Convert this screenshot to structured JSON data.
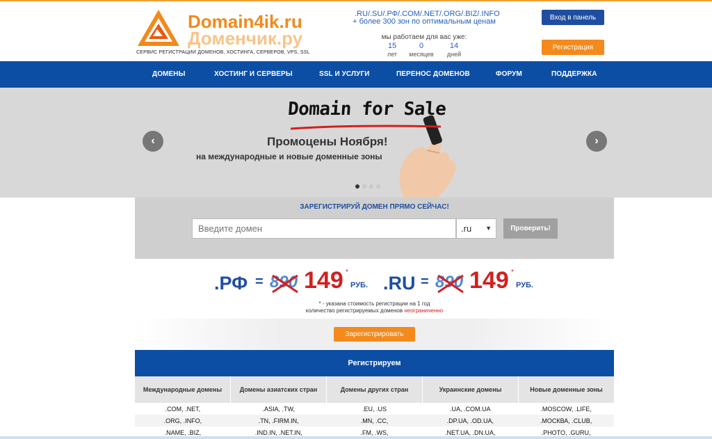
{
  "header": {
    "logo_en": "Domain4ik.ru",
    "logo_ru": "Доменчик.ру",
    "tagline": "СЕРВИС РЕГИСТРАЦИИ ДОМЕНОВ, ХОСТИНГА, СЕРВЕРОВ, VPS, SSL",
    "zones_line1": ".RU/.SU/.РФ/.COM/.NET/.ORG/.BIZ/.INFO",
    "zones_line2": "+ более 300 зон по оптимальным ценам",
    "working_label": "мы работаем для вас уже:",
    "counters": [
      {
        "value": "15",
        "unit": "лет"
      },
      {
        "value": "0",
        "unit": "месяцев"
      },
      {
        "value": "14",
        "unit": "дней"
      }
    ],
    "login_label": "Вход в панель",
    "register_label": "Регистрация"
  },
  "nav": {
    "items": [
      {
        "label": "ДОМЕНЫ"
      },
      {
        "label": "ХОСТИНГ И СЕРВЕРЫ"
      },
      {
        "label": "SSL И УСЛУГИ"
      },
      {
        "label": "ПЕРЕНОС ДОМЕНОВ"
      },
      {
        "label": "ФОРУМ"
      },
      {
        "label": "ПОДДЕРЖКА"
      }
    ]
  },
  "banner": {
    "title": "Domain for Sale",
    "promo_line1": "Промоцены Ноября!",
    "promo_line2": "на международные и новые доменные зоны",
    "prev_icon": "chevron-left-icon",
    "next_icon": "chevron-right-icon",
    "slides_total": 4,
    "active_slide": 1
  },
  "search": {
    "title": "ЗАРЕГИСТРИРУЙ ДОМЕН ПРЯМО СЕЙЧАС!",
    "placeholder": "Введите домен",
    "zone_selected": ".ru",
    "check_label": "Проверить!"
  },
  "prices": [
    {
      "zone": ".РФ",
      "eq": "=",
      "old": "890",
      "new": "149",
      "star": "*",
      "currency": "РУБ."
    },
    {
      "zone": ".RU",
      "eq": "=",
      "old": "890",
      "new": "149",
      "star": "*",
      "currency": "РУБ."
    }
  ],
  "notes": {
    "line1": "* - указана стоимость регистрации на 1 год",
    "line2_prefix": "количество регистрируемых доменов ",
    "line2_highlight": "неограниченно"
  },
  "register_button": "Зарегистрировать",
  "table": {
    "title": "Регистрируем",
    "columns": [
      "Международные домены",
      "Домены азиатских стран",
      "Домены других стран",
      "Украинские домены",
      "Новые доменные зоны"
    ],
    "rows": [
      [
        ".COM, .NET,",
        ".ASIA, .TW,",
        ".EU, .US",
        ".UA, .COM.UA",
        ".MOSCOW, .LIFE,"
      ],
      [
        ".ORG, .INFO,",
        ".TN, .FIRM.IN,",
        ".MN, .CC,",
        ".DP.UA, .OD.UA,",
        ".МОСКВА, .CLUB,"
      ],
      [
        ".NAME, .BIZ,",
        ".IND.IN, .NET.IN,",
        ".FM, .WS,",
        ".NET.UA, .DN.UA,",
        ".PHOTO, .GURU,"
      ]
    ]
  },
  "colors": {
    "brand_blue": "#0d4ea5",
    "brand_orange": "#f48a1c",
    "price_red": "#d12020"
  }
}
